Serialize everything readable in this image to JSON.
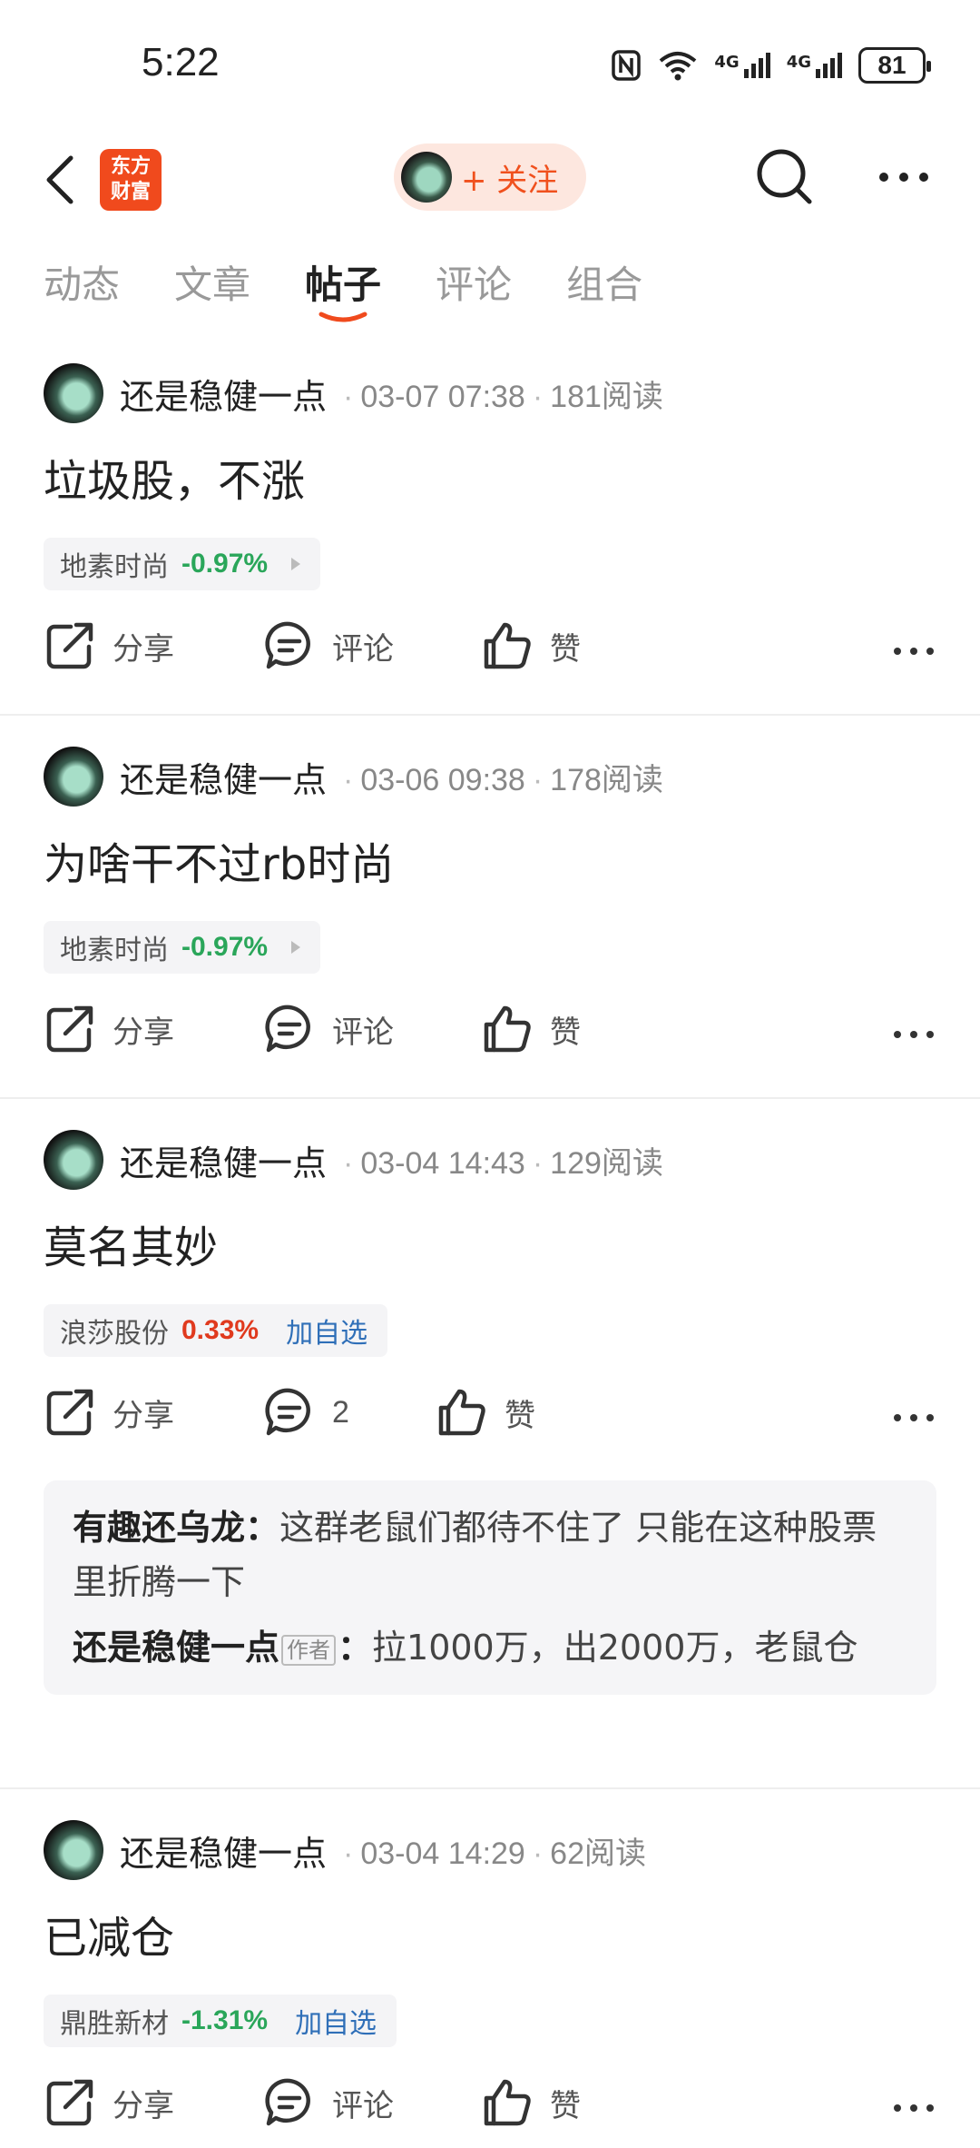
{
  "status_bar": {
    "time": "5:22",
    "network_1": "4G",
    "network_2": "4G",
    "battery": "81"
  },
  "header": {
    "logo_line1": "东方",
    "logo_line2": "财富",
    "follow_label": "+ 关注"
  },
  "tabs": [
    "动态",
    "文章",
    "帖子",
    "评论",
    "组合"
  ],
  "active_tab_index": 2,
  "posts": [
    {
      "author": "还是稳健一点",
      "date": "03-07 07:38",
      "reads": "181阅读",
      "title": "垃圾股，不涨",
      "stock": {
        "name": "地素时尚",
        "change": "-0.97%",
        "direction": "down",
        "extra": ""
      },
      "share_label": "分享",
      "comment_label": "评论",
      "like_label": "赞"
    },
    {
      "author": "还是稳健一点",
      "date": "03-06 09:38",
      "reads": "178阅读",
      "title": "为啥干不过rb时尚",
      "stock": {
        "name": "地素时尚",
        "change": "-0.97%",
        "direction": "down",
        "extra": ""
      },
      "share_label": "分享",
      "comment_label": "评论",
      "like_label": "赞"
    },
    {
      "author": "还是稳健一点",
      "date": "03-04 14:43",
      "reads": "129阅读",
      "title": "莫名其妙",
      "stock": {
        "name": "浪莎股份",
        "change": "0.33%",
        "direction": "up",
        "extra": "加自选"
      },
      "share_label": "分享",
      "comment_label": "2",
      "like_label": "赞",
      "comments": [
        {
          "author": "有趣还乌龙",
          "sep": "：",
          "tag": "",
          "text": "这群老鼠们都待不住了 只能在这种股票里折腾一下"
        },
        {
          "author": "还是稳健一点",
          "sep": "：",
          "tag": "作者",
          "text": "拉1000万，出2000万，老鼠仓"
        }
      ]
    },
    {
      "author": "还是稳健一点",
      "date": "03-04 14:29",
      "reads": "62阅读",
      "title": "已减仓",
      "stock": {
        "name": "鼎胜新材",
        "change": "-1.31%",
        "direction": "down",
        "extra": "加自选"
      },
      "share_label": "分享",
      "comment_label": "评论",
      "like_label": "赞"
    }
  ],
  "colors": {
    "brand": "#f04a1d",
    "down": "#2aa65a",
    "up": "#e03a1e",
    "link": "#2f6fb8"
  }
}
